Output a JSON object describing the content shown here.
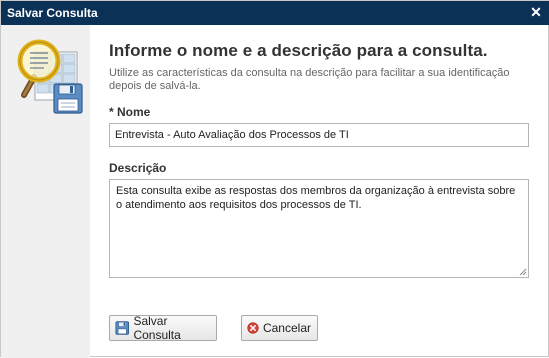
{
  "window": {
    "title": "Salvar Consulta",
    "close_symbol": "✕"
  },
  "sidebar": {
    "icon": "magnifier-table-floppy-icon"
  },
  "form": {
    "heading": "Informe o nome e a descrição para a consulta.",
    "hint": "Utilize as características da consulta na descrição para facilitar a sua identificação depois de salvá-la.",
    "name_label": "* Nome",
    "name_value": "Entrevista - Auto Avaliação dos Processos de TI",
    "description_label": "Descrição",
    "description_value": "Esta consulta exibe as respostas dos membros da organização à entrevista sobre o atendimento aos requisitos dos processos de TI."
  },
  "buttons": {
    "save_label": "Salvar Consulta",
    "cancel_label": "Cancelar"
  },
  "colors": {
    "titlebar": "#0b3157",
    "sidebar": "#f0f0f0",
    "cancel_icon": "#d9443b"
  }
}
